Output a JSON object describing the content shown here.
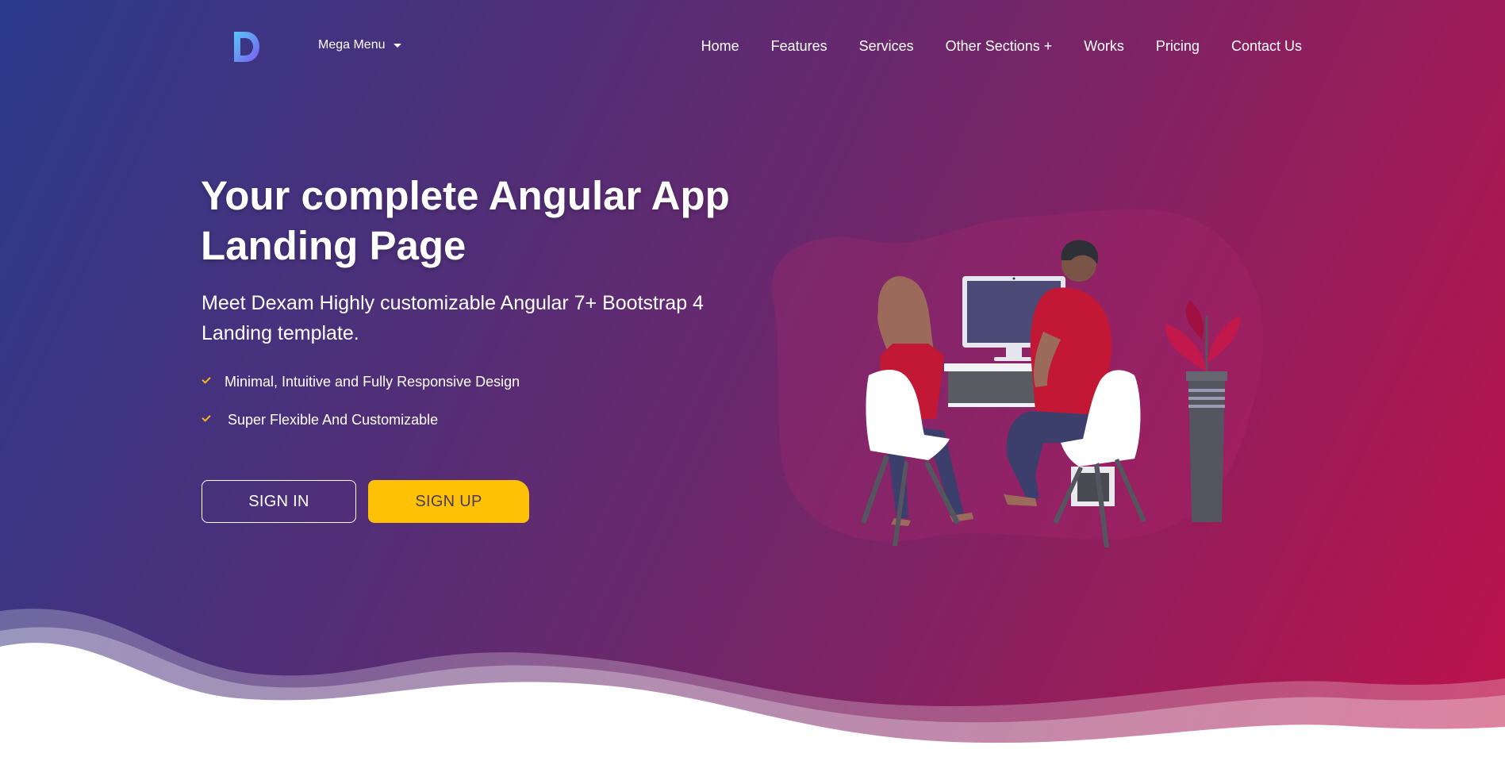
{
  "header": {
    "logo_letter": "D",
    "mega_menu_label": "Mega Menu",
    "nav": [
      "Home",
      "Features",
      "Services",
      "Other Sections +",
      "Works",
      "Pricing",
      "Contact Us"
    ]
  },
  "hero": {
    "headline_line1": "Your complete Angular App",
    "headline_line2": "Landing Page",
    "subline_line1": "Meet Dexam Highly customizable Angular 7+ Bootstrap 4",
    "subline_line2": "Landing template.",
    "features": [
      "Minimal, Intuitive and Fully Responsive Design",
      "Super Flexible And Customizable"
    ],
    "signin_label": "SIGN IN",
    "signup_label": "SIGN UP"
  },
  "colors": {
    "gradient_start": "#2b3a8c",
    "gradient_end": "#c0124a",
    "accent_yellow": "#ffc106",
    "white": "#ffffff"
  },
  "icons": [
    "logo-icon",
    "chevron-down-icon",
    "check-icon",
    "office-illustration-icon"
  ]
}
